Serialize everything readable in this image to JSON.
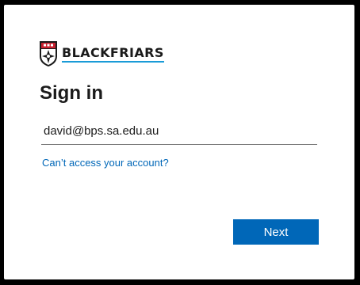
{
  "brand": {
    "logo_text": "BLACKFRIARS",
    "crest_icon": "school-crest-icon",
    "accent_color": "#1a9bd7"
  },
  "signin": {
    "title": "Sign in",
    "email_value": "david@bps.sa.edu.au",
    "cant_access_link": "Can’t access your account?",
    "next_label": "Next",
    "primary_color": "#0067b8"
  }
}
